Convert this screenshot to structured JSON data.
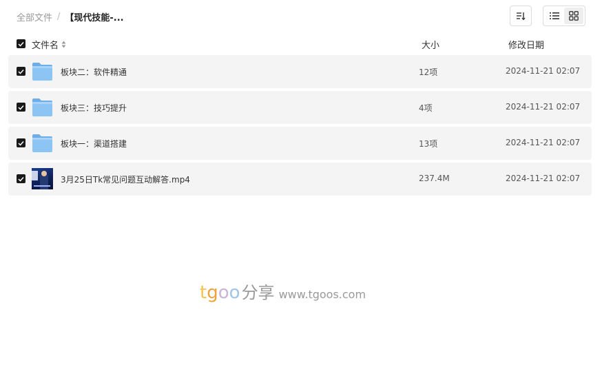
{
  "breadcrumb": {
    "root": "全部文件",
    "separator": "/",
    "current": "【现代技能-..."
  },
  "toolbar": {
    "sort_icon": "sort-descending-icon",
    "list_view_icon": "list-view-icon",
    "grid_view_icon": "grid-view-icon",
    "active_view": "grid"
  },
  "header": {
    "name": "文件名",
    "size": "大小",
    "date": "修改日期"
  },
  "files": [
    {
      "name": "板块二：软件精通",
      "size": "12项",
      "date": "2024-11-21 02:07",
      "type": "folder"
    },
    {
      "name": "板块三：技巧提升",
      "size": "4项",
      "date": "2024-11-21 02:07",
      "type": "folder"
    },
    {
      "name": "板块一：渠道搭建",
      "size": "13项",
      "date": "2024-11-21 02:07",
      "type": "folder"
    },
    {
      "name": "3月25日Tk常见问题互动解答.mp4",
      "size": "237.4M",
      "date": "2024-11-21 02:07",
      "type": "video"
    }
  ],
  "watermark": {
    "t": "t",
    "g": "g",
    "o1": "o",
    "o2": "o",
    "cn": "分享",
    "url": "www.tgoos.com"
  },
  "colors": {
    "row_bg": "#f4f4f4",
    "folder": "#7ab8f0",
    "checkbox": "#1a1a1a"
  }
}
